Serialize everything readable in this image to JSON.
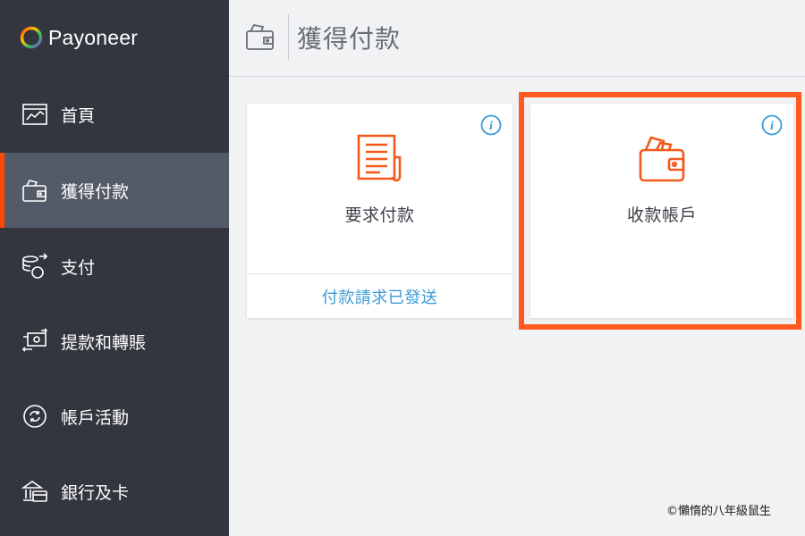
{
  "brand": {
    "name": "Payoneer"
  },
  "sidebar": {
    "items": [
      {
        "label": "首頁",
        "icon": "dashboard-chart-icon",
        "active": false
      },
      {
        "label": "獲得付款",
        "icon": "wallet-icon",
        "active": true
      },
      {
        "label": "支付",
        "icon": "coins-transfer-icon",
        "active": false
      },
      {
        "label": "提款和轉賬",
        "icon": "withdraw-transfer-icon",
        "active": false
      },
      {
        "label": "帳戶活動",
        "icon": "activity-cycle-icon",
        "active": false
      },
      {
        "label": "銀行及卡",
        "icon": "bank-card-icon",
        "active": false
      }
    ]
  },
  "header": {
    "title": "獲得付款",
    "icon": "wallet-icon"
  },
  "cards": [
    {
      "title": "要求付款",
      "icon": "invoice-document-icon",
      "info_icon": "info-icon",
      "footer_link": "付款請求已發送"
    },
    {
      "title": "收款帳戶",
      "icon": "wallet-money-icon",
      "info_icon": "info-icon"
    }
  ],
  "colors": {
    "accent": "#ff4800",
    "highlight": "#ff5a1f",
    "link": "#3a9bd6",
    "sidebar_bg": "#33363f",
    "sidebar_active": "#545b68"
  },
  "watermark": "©懶惰的八年級鼠生"
}
